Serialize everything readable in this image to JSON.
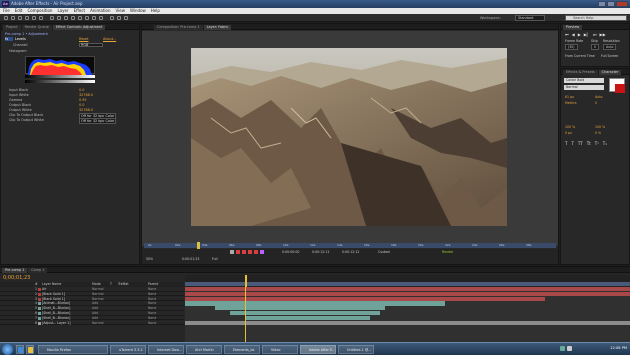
{
  "window": {
    "title": "Adobe After Effects - Air Project.aep"
  },
  "menu": [
    "File",
    "Edit",
    "Composition",
    "Layer",
    "Effect",
    "Animation",
    "View",
    "Window",
    "Help"
  ],
  "toolbar": {
    "workspace_label": "Workspace:",
    "workspace_value": "Standard",
    "search_placeholder": "Search Help"
  },
  "left_panel": {
    "tabs": [
      "Project",
      "Render Queue",
      "Effect Controls: Adjustment"
    ],
    "layer_ref": "Pre-comp 1 • Adjustment",
    "effect_name": "Levels",
    "effect_reset": "Reset",
    "effect_about": "About...",
    "channel_label": "Channel:",
    "channel_value": "RGB",
    "histogram_label": "Histogram",
    "rows": [
      {
        "label": "Input Black",
        "value": "0.0"
      },
      {
        "label": "Input White",
        "value": "32768.0"
      },
      {
        "label": "Gamma",
        "value": "0.95"
      },
      {
        "label": "Output Black",
        "value": "0.0"
      },
      {
        "label": "Output White",
        "value": "32768.0"
      },
      {
        "label": "Clip To Output Black",
        "value": "Off for 32 bpc Color"
      },
      {
        "label": "Clip To Output White",
        "value": "Off for 32 bpc Color"
      }
    ]
  },
  "comp_panel": {
    "tabs": [
      "Composition: Pre-comp 1",
      "Layer: Fabric"
    ],
    "ruler": [
      "0s",
      "02s",
      "04s",
      "06s",
      "08s",
      "10s",
      "12s",
      "14s",
      "16s",
      "18s",
      "20s",
      "22s",
      "24s",
      "26s",
      "28s"
    ],
    "zoom": "50%",
    "timecode": "0:00:01:23",
    "view": "Full",
    "render_label": "Render",
    "counts": [
      "0:00:00:00",
      "0:00:12:11",
      "0:00:12:12"
    ],
    "view_select": "Custom"
  },
  "right_panel": {
    "preview_tabs": [
      "Preview"
    ],
    "preview_labels": {
      "frame_rate": "Frame Rate",
      "skip": "Skip",
      "resolution": "Resolution",
      "fps_value": "(30)",
      "skip_value": "0",
      "res_value": "Auto",
      "from_current": "From Current Time",
      "full_screen": "Full Screen"
    },
    "char_tabs": [
      "Effects & Presets",
      "Character"
    ],
    "font": "Calibri Bold",
    "style": "Normal",
    "size": "61 px",
    "leading": "Auto",
    "tracking": "0",
    "kerning": "Metrics",
    "vscale": "100 %",
    "hscale": "100 %",
    "baseline": "0 px",
    "tsume": "0 %"
  },
  "timeline": {
    "tabs": [
      "Pre-comp 1",
      "Comp 1"
    ],
    "timecode": "0;00;01;23",
    "columns": [
      "#",
      "Layer Name",
      "Mode",
      "T",
      "TrkMat",
      "Parent"
    ],
    "layers": [
      {
        "num": "1",
        "name": "Air",
        "mode": "Normal",
        "parent": "None",
        "color": "#b04040"
      },
      {
        "num": "2",
        "name": "[Black Solid 1]",
        "mode": "Normal",
        "parent": "None",
        "color": "#b04040"
      },
      {
        "num": "3",
        "name": "[Black Solid 1]",
        "mode": "Normal",
        "parent": "None",
        "color": "#b04040"
      },
      {
        "num": "4",
        "name": "[Animat...Blurion]",
        "mode": "Add",
        "parent": "None",
        "color": "#6fa39a"
      },
      {
        "num": "5",
        "name": "[Shell_B...Blurion]",
        "mode": "Add",
        "parent": "None",
        "color": "#6fa39a"
      },
      {
        "num": "6",
        "name": "[Shell_B...Blurion]",
        "mode": "Add",
        "parent": "None",
        "color": "#6fa39a"
      },
      {
        "num": "7",
        "name": "[Shell_B...Blurion]",
        "mode": "Add",
        "parent": "None",
        "color": "#6fa39a"
      },
      {
        "num": "8",
        "name": "[Adjust... Layer 1]",
        "mode": "Normal",
        "parent": "None",
        "color": "#a0a0a0"
      }
    ],
    "ruler": [
      "00s",
      "02s",
      "04s",
      "06s",
      "08s",
      "10s",
      "12s",
      "14s",
      "16s",
      "18s",
      "20s",
      "22s",
      "24s",
      "26s",
      "28s"
    ]
  },
  "taskbar": {
    "items": [
      "Mozilla Firefox",
      "uTorrent 3.3.2",
      "Internet Dow...",
      "Ahri Martin",
      "Elements_bs",
      "Video",
      "Adobe After E...",
      "Untitled-1 @..."
    ],
    "clock": "12:08 PM"
  }
}
